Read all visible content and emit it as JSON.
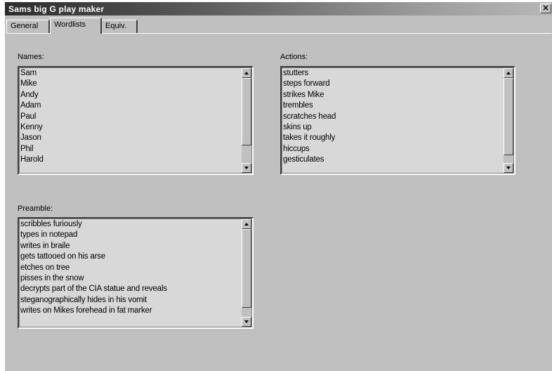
{
  "window": {
    "title": "Sams big G play maker",
    "close_label": "×"
  },
  "tabs": [
    {
      "label": "General",
      "active": false
    },
    {
      "label": "Wordlists",
      "active": true
    },
    {
      "label": "Equiv.",
      "active": false
    }
  ],
  "names": {
    "label": "Names:",
    "items": [
      "Sam",
      "Mike",
      "Andy",
      "Adam",
      "Paul",
      "Kenny",
      "Jason",
      "Phil",
      "Harold"
    ]
  },
  "actions": {
    "label": "Actions:",
    "items": [
      "stutters",
      "steps forward",
      "strikes Mike",
      "trembles",
      "scratches head",
      "skins up",
      "takes it roughly",
      "hiccups",
      "gesticulates"
    ]
  },
  "preamble": {
    "label": "Preamble:",
    "items": [
      "scribbles furiously",
      "types in notepad",
      "writes in braile",
      "gets tattooed on his arse",
      "etches on tree",
      "pisses in the snow",
      "decrypts part of the CIA statue and reveals",
      "steganographically hides in his vomit",
      "writes on Mikes forehead in fat marker"
    ]
  }
}
